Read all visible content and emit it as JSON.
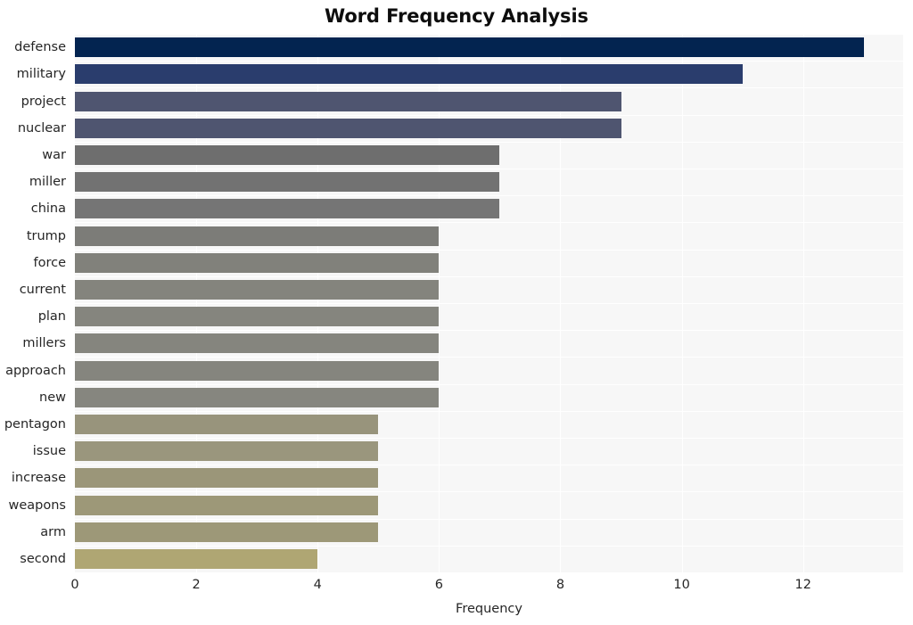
{
  "chart_data": {
    "type": "bar",
    "orientation": "horizontal",
    "title": "Word Frequency Analysis",
    "xlabel": "Frequency",
    "ylabel": "",
    "xlim": [
      0,
      13.65
    ],
    "xticks": [
      0,
      2,
      4,
      6,
      8,
      10,
      12
    ],
    "xticklabels": [
      "0",
      "2",
      "4",
      "6",
      "8",
      "10",
      "12"
    ],
    "grid": true,
    "grid_color": "#ffffff",
    "plot_background": "#f7f7f7",
    "legend": null,
    "categories": [
      "defense",
      "military",
      "project",
      "nuclear",
      "war",
      "miller",
      "china",
      "trump",
      "force",
      "current",
      "plan",
      "millers",
      "approach",
      "new",
      "pentagon",
      "issue",
      "increase",
      "weapons",
      "arm",
      "second"
    ],
    "values": [
      13,
      11,
      9,
      9,
      7,
      7,
      7,
      6,
      6,
      6,
      6,
      6,
      6,
      6,
      5,
      5,
      5,
      5,
      5,
      4
    ],
    "bar_colors": [
      "#032450",
      "#2a3d6d",
      "#4f5570",
      "#4f5570",
      "#6e6e6e",
      "#727272",
      "#757575",
      "#7c7c78",
      "#81817b",
      "#84847d",
      "#85857e",
      "#85857e",
      "#85857e",
      "#86867f",
      "#98947c",
      "#9a967d",
      "#9b9679",
      "#9d9878",
      "#9d9878",
      "#afa673"
    ]
  }
}
